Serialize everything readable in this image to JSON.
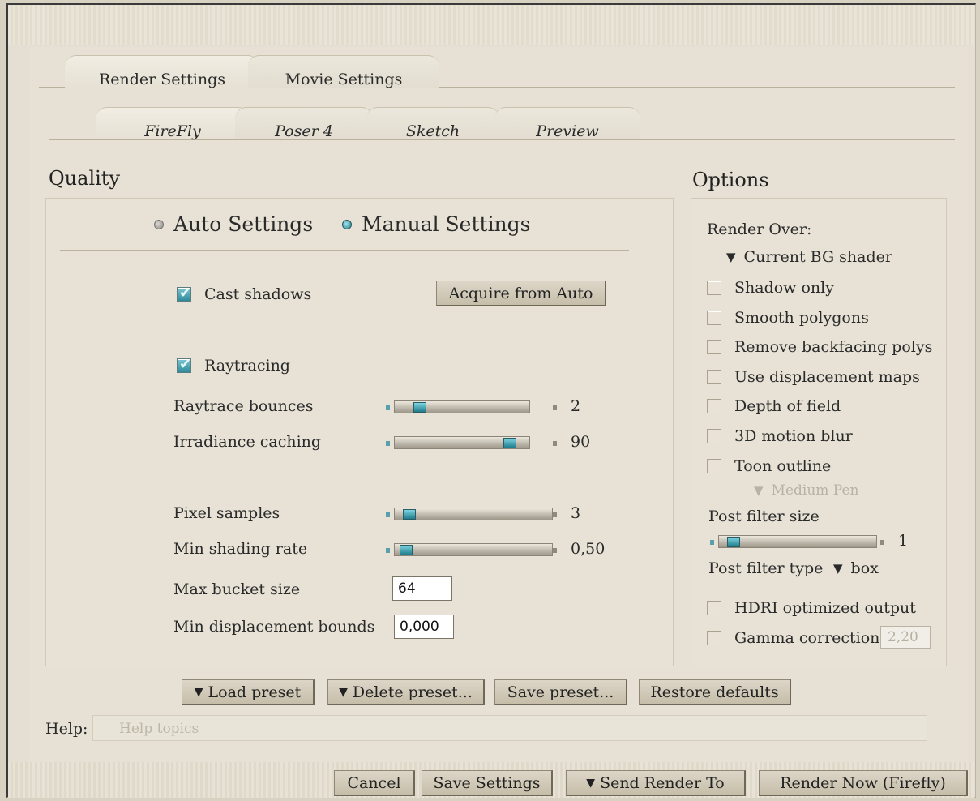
{
  "tabs": {
    "main": [
      "Render Settings",
      "Movie Settings"
    ],
    "sub": [
      "FireFly",
      "Poser 4",
      "Sketch",
      "Preview"
    ]
  },
  "quality": {
    "title": "Quality",
    "auto_label": "Auto Settings",
    "manual_label": "Manual Settings",
    "selected": "manual",
    "cast_shadows": {
      "label": "Cast shadows",
      "checked": true
    },
    "acquire_button": "Acquire from Auto",
    "raytracing": {
      "label": "Raytracing",
      "checked": true
    },
    "sliders": [
      {
        "label": "Raytrace bounces",
        "value": "2",
        "fraction": 0.15
      },
      {
        "label": "Irradiance caching",
        "value": "90",
        "fraction": 0.9
      },
      {
        "label": "Pixel samples",
        "value": "3",
        "fraction": 0.05
      },
      {
        "label": "Min shading rate",
        "value": "0,50",
        "fraction": 0.03
      }
    ],
    "max_bucket_label": "Max bucket size",
    "max_bucket_value": "64",
    "min_disp_label": "Min displacement bounds",
    "min_disp_value": "0,000"
  },
  "options": {
    "title": "Options",
    "render_over_label": "Render Over:",
    "render_over_value": "Current BG shader",
    "checkboxes": [
      "Shadow only",
      "Smooth polygons",
      "Remove backfacing polys",
      "Use displacement maps",
      "Depth of field",
      "3D motion blur",
      "Toon outline"
    ],
    "toon_pen": "Medium Pen",
    "post_filter_size_label": "Post filter size",
    "post_filter_size_value": "1",
    "post_filter_size_fraction": 0.05,
    "post_filter_type_label": "Post filter type",
    "post_filter_type_value": "box",
    "hdri_label": "HDRI optimized output",
    "gamma_label": "Gamma correction",
    "gamma_value": "2,20"
  },
  "presets": {
    "load": "Load preset",
    "delete": "Delete preset...",
    "save": "Save preset...",
    "restore": "Restore defaults"
  },
  "help": {
    "label": "Help:",
    "placeholder": "Help topics"
  },
  "footer": {
    "cancel": "Cancel",
    "save_settings": "Save Settings",
    "send_render_to": "Send Render To",
    "render_now": "Render Now (Firefly)"
  },
  "colors": {
    "accent": "#2d8a9a",
    "panel": "#e6e1d4"
  }
}
